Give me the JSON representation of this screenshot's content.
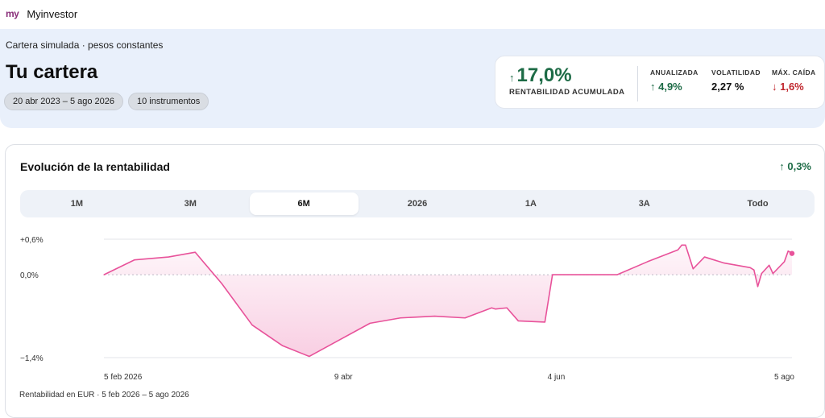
{
  "app": {
    "logo": "my",
    "name": "Myinvestor"
  },
  "hero": {
    "subtitle": "Cartera simulada · pesos constantes",
    "title": "Tu cartera",
    "chips": [
      "20 abr 2023 – 5 ago 2026",
      "10 instrumentos"
    ]
  },
  "stats": {
    "main": {
      "arrow": "↑",
      "value": "17,0%",
      "label": "RENTABILIDAD ACUMULADA"
    },
    "annualized": {
      "label": "ANUALIZADA",
      "value": "↑ 4,9%"
    },
    "volatility": {
      "label": "VOLATILIDAD",
      "value": "2,27 %"
    },
    "max_drop": {
      "label": "MÁX. CAÍDA",
      "value": "↓ 1,6%"
    }
  },
  "card": {
    "title": "Evolución de la rentabilidad",
    "change": "↑ 0,3%",
    "tabs": [
      "1M",
      "3M",
      "6M",
      "2026",
      "1A",
      "3A",
      "Todo"
    ],
    "active_tab": "6M",
    "footnote": "Rentabilidad en EUR · 5 feb 2026 – 5 ago 2026"
  },
  "colors": {
    "accent": "#e8529a",
    "positive": "#1d6b46",
    "negative": "#c0262d"
  },
  "chart_data": {
    "type": "area",
    "y_ticks": [
      "+0,6%",
      "0,0%",
      "−1,4%"
    ],
    "x_ticks": [
      "5 feb 2026",
      "9 abr",
      "4 jun",
      "5 ago"
    ],
    "ylim": [
      -1.4,
      0.6
    ],
    "x_range": [
      "2026-02-05",
      "2026-08-05"
    ],
    "x": [
      "2026-02-05",
      "2026-02-13",
      "2026-02-22",
      "2026-03-01",
      "2026-03-08",
      "2026-03-16",
      "2026-03-24",
      "2026-03-31",
      "2026-04-08",
      "2026-04-16",
      "2026-04-24",
      "2026-05-03",
      "2026-05-11",
      "2026-05-18",
      "2026-05-19",
      "2026-05-22",
      "2026-05-25",
      "2026-06-01",
      "2026-06-03",
      "2026-06-12",
      "2026-06-20",
      "2026-06-28",
      "2026-07-06",
      "2026-07-07",
      "2026-07-08",
      "2026-07-10",
      "2026-07-13",
      "2026-07-18",
      "2026-07-25",
      "2026-07-26",
      "2026-07-27",
      "2026-07-28",
      "2026-07-30",
      "2026-07-31",
      "2026-08-03",
      "2026-08-04",
      "2026-08-05"
    ],
    "values": [
      0.0,
      0.25,
      0.3,
      0.38,
      -0.15,
      -0.85,
      -1.2,
      -1.38,
      -1.1,
      -0.82,
      -0.73,
      -0.7,
      -0.73,
      -0.56,
      -0.58,
      -0.56,
      -0.78,
      -0.8,
      0.0,
      0.0,
      0.0,
      0.22,
      0.42,
      0.5,
      0.5,
      0.1,
      0.3,
      0.2,
      0.12,
      0.08,
      -0.2,
      0.02,
      0.16,
      0.02,
      0.22,
      0.4,
      0.36
    ],
    "grid": true,
    "legend": "none"
  }
}
